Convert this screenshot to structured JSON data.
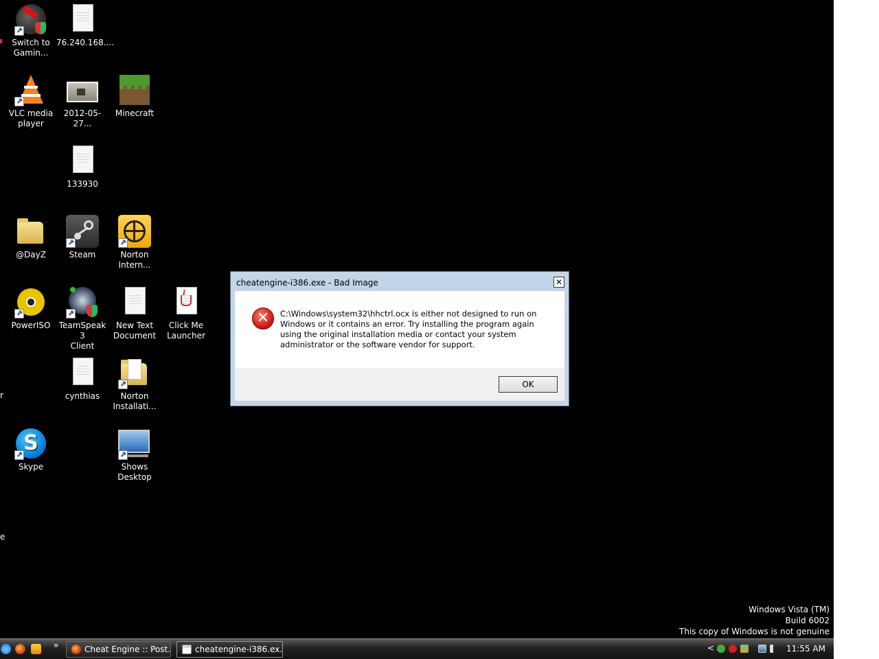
{
  "desktop": {
    "icons": [
      {
        "label": "Switch to\nGamin...",
        "icon": "gaming-mode-icon"
      },
      {
        "label": "76.240.168....",
        "icon": "text-file-icon"
      },
      {
        "label": "VLC media\nplayer",
        "icon": "vlc-icon"
      },
      {
        "label": "2012-05-27...",
        "icon": "image-file-icon"
      },
      {
        "label": "Minecraft",
        "icon": "minecraft-icon"
      },
      {
        "label": "133930",
        "icon": "text-file-icon"
      },
      {
        "label": "@DayZ",
        "icon": "folder-icon"
      },
      {
        "label": "Steam",
        "icon": "steam-icon"
      },
      {
        "label": "Norton\nIntern...",
        "icon": "norton-internet-icon"
      },
      {
        "label": "PowerISO",
        "icon": "poweriso-icon"
      },
      {
        "label": "TeamSpeak 3\nClient",
        "icon": "teamspeak-icon"
      },
      {
        "label": "New Text\nDocument",
        "icon": "text-file-icon"
      },
      {
        "label": "Click Me\nLauncher",
        "icon": "java-file-icon"
      },
      {
        "label": "cynthias",
        "icon": "text-file-icon"
      },
      {
        "label": "Norton\nInstallati...",
        "icon": "folder-icon"
      },
      {
        "label": "Skype",
        "icon": "skype-icon"
      },
      {
        "label": "Shows\nDesktop",
        "icon": "show-desktop-icon"
      }
    ],
    "edge_fragments": [
      "r",
      "e"
    ]
  },
  "dialog": {
    "title": "cheatengine-i386.exe - Bad Image",
    "close_label": "✕",
    "message": "C:\\Windows\\system32\\hhctrl.ocx is either not designed to run on Windows or it contains an error. Try installing the program again using the original installation media or contact your system administrator or the software vendor for support.",
    "ok_label": "OK",
    "icon": "error-icon"
  },
  "watermark": {
    "line1": "Windows Vista (TM)",
    "line2": "Build 6002",
    "line3": "This copy of Windows is not genuine"
  },
  "taskbar": {
    "quick_launch_icons": [
      "ie-icon",
      "firefox-icon",
      "media-player-icon"
    ],
    "overflow_label": "»",
    "buttons": [
      {
        "label": "Cheat Engine :: Post...",
        "icon": "firefox-icon"
      },
      {
        "label": "cheatengine-i386.ex...",
        "icon": "window-icon"
      }
    ],
    "tray": {
      "expand_label": "<",
      "icons": [
        "norton-icon",
        "error-tray-icon",
        "network-app-icon",
        "network-icon",
        "volume-icon"
      ],
      "clock": "11:55 AM"
    }
  },
  "colors": {
    "desktop_background": "#000000",
    "dialog_titlebar": "#c1d4e8",
    "error_red": "#c91010"
  }
}
